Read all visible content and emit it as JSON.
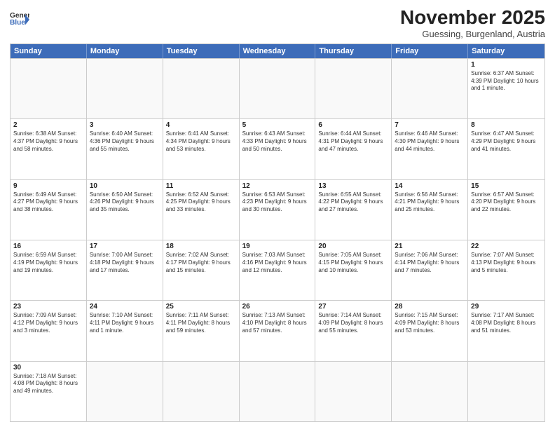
{
  "logo": {
    "line1": "General",
    "line2": "Blue"
  },
  "title": "November 2025",
  "subtitle": "Guessing, Burgenland, Austria",
  "days_of_week": [
    "Sunday",
    "Monday",
    "Tuesday",
    "Wednesday",
    "Thursday",
    "Friday",
    "Saturday"
  ],
  "weeks": [
    [
      {
        "day": "",
        "info": ""
      },
      {
        "day": "",
        "info": ""
      },
      {
        "day": "",
        "info": ""
      },
      {
        "day": "",
        "info": ""
      },
      {
        "day": "",
        "info": ""
      },
      {
        "day": "",
        "info": ""
      },
      {
        "day": "1",
        "info": "Sunrise: 6:37 AM\nSunset: 4:39 PM\nDaylight: 10 hours and 1 minute."
      }
    ],
    [
      {
        "day": "2",
        "info": "Sunrise: 6:38 AM\nSunset: 4:37 PM\nDaylight: 9 hours and 58 minutes."
      },
      {
        "day": "3",
        "info": "Sunrise: 6:40 AM\nSunset: 4:36 PM\nDaylight: 9 hours and 55 minutes."
      },
      {
        "day": "4",
        "info": "Sunrise: 6:41 AM\nSunset: 4:34 PM\nDaylight: 9 hours and 53 minutes."
      },
      {
        "day": "5",
        "info": "Sunrise: 6:43 AM\nSunset: 4:33 PM\nDaylight: 9 hours and 50 minutes."
      },
      {
        "day": "6",
        "info": "Sunrise: 6:44 AM\nSunset: 4:31 PM\nDaylight: 9 hours and 47 minutes."
      },
      {
        "day": "7",
        "info": "Sunrise: 6:46 AM\nSunset: 4:30 PM\nDaylight: 9 hours and 44 minutes."
      },
      {
        "day": "8",
        "info": "Sunrise: 6:47 AM\nSunset: 4:29 PM\nDaylight: 9 hours and 41 minutes."
      }
    ],
    [
      {
        "day": "9",
        "info": "Sunrise: 6:49 AM\nSunset: 4:27 PM\nDaylight: 9 hours and 38 minutes."
      },
      {
        "day": "10",
        "info": "Sunrise: 6:50 AM\nSunset: 4:26 PM\nDaylight: 9 hours and 35 minutes."
      },
      {
        "day": "11",
        "info": "Sunrise: 6:52 AM\nSunset: 4:25 PM\nDaylight: 9 hours and 33 minutes."
      },
      {
        "day": "12",
        "info": "Sunrise: 6:53 AM\nSunset: 4:23 PM\nDaylight: 9 hours and 30 minutes."
      },
      {
        "day": "13",
        "info": "Sunrise: 6:55 AM\nSunset: 4:22 PM\nDaylight: 9 hours and 27 minutes."
      },
      {
        "day": "14",
        "info": "Sunrise: 6:56 AM\nSunset: 4:21 PM\nDaylight: 9 hours and 25 minutes."
      },
      {
        "day": "15",
        "info": "Sunrise: 6:57 AM\nSunset: 4:20 PM\nDaylight: 9 hours and 22 minutes."
      }
    ],
    [
      {
        "day": "16",
        "info": "Sunrise: 6:59 AM\nSunset: 4:19 PM\nDaylight: 9 hours and 19 minutes."
      },
      {
        "day": "17",
        "info": "Sunrise: 7:00 AM\nSunset: 4:18 PM\nDaylight: 9 hours and 17 minutes."
      },
      {
        "day": "18",
        "info": "Sunrise: 7:02 AM\nSunset: 4:17 PM\nDaylight: 9 hours and 15 minutes."
      },
      {
        "day": "19",
        "info": "Sunrise: 7:03 AM\nSunset: 4:16 PM\nDaylight: 9 hours and 12 minutes."
      },
      {
        "day": "20",
        "info": "Sunrise: 7:05 AM\nSunset: 4:15 PM\nDaylight: 9 hours and 10 minutes."
      },
      {
        "day": "21",
        "info": "Sunrise: 7:06 AM\nSunset: 4:14 PM\nDaylight: 9 hours and 7 minutes."
      },
      {
        "day": "22",
        "info": "Sunrise: 7:07 AM\nSunset: 4:13 PM\nDaylight: 9 hours and 5 minutes."
      }
    ],
    [
      {
        "day": "23",
        "info": "Sunrise: 7:09 AM\nSunset: 4:12 PM\nDaylight: 9 hours and 3 minutes."
      },
      {
        "day": "24",
        "info": "Sunrise: 7:10 AM\nSunset: 4:11 PM\nDaylight: 9 hours and 1 minute."
      },
      {
        "day": "25",
        "info": "Sunrise: 7:11 AM\nSunset: 4:11 PM\nDaylight: 8 hours and 59 minutes."
      },
      {
        "day": "26",
        "info": "Sunrise: 7:13 AM\nSunset: 4:10 PM\nDaylight: 8 hours and 57 minutes."
      },
      {
        "day": "27",
        "info": "Sunrise: 7:14 AM\nSunset: 4:09 PM\nDaylight: 8 hours and 55 minutes."
      },
      {
        "day": "28",
        "info": "Sunrise: 7:15 AM\nSunset: 4:09 PM\nDaylight: 8 hours and 53 minutes."
      },
      {
        "day": "29",
        "info": "Sunrise: 7:17 AM\nSunset: 4:08 PM\nDaylight: 8 hours and 51 minutes."
      }
    ],
    [
      {
        "day": "30",
        "info": "Sunrise: 7:18 AM\nSunset: 4:08 PM\nDaylight: 8 hours and 49 minutes."
      },
      {
        "day": "",
        "info": ""
      },
      {
        "day": "",
        "info": ""
      },
      {
        "day": "",
        "info": ""
      },
      {
        "day": "",
        "info": ""
      },
      {
        "day": "",
        "info": ""
      },
      {
        "day": "",
        "info": ""
      }
    ]
  ]
}
